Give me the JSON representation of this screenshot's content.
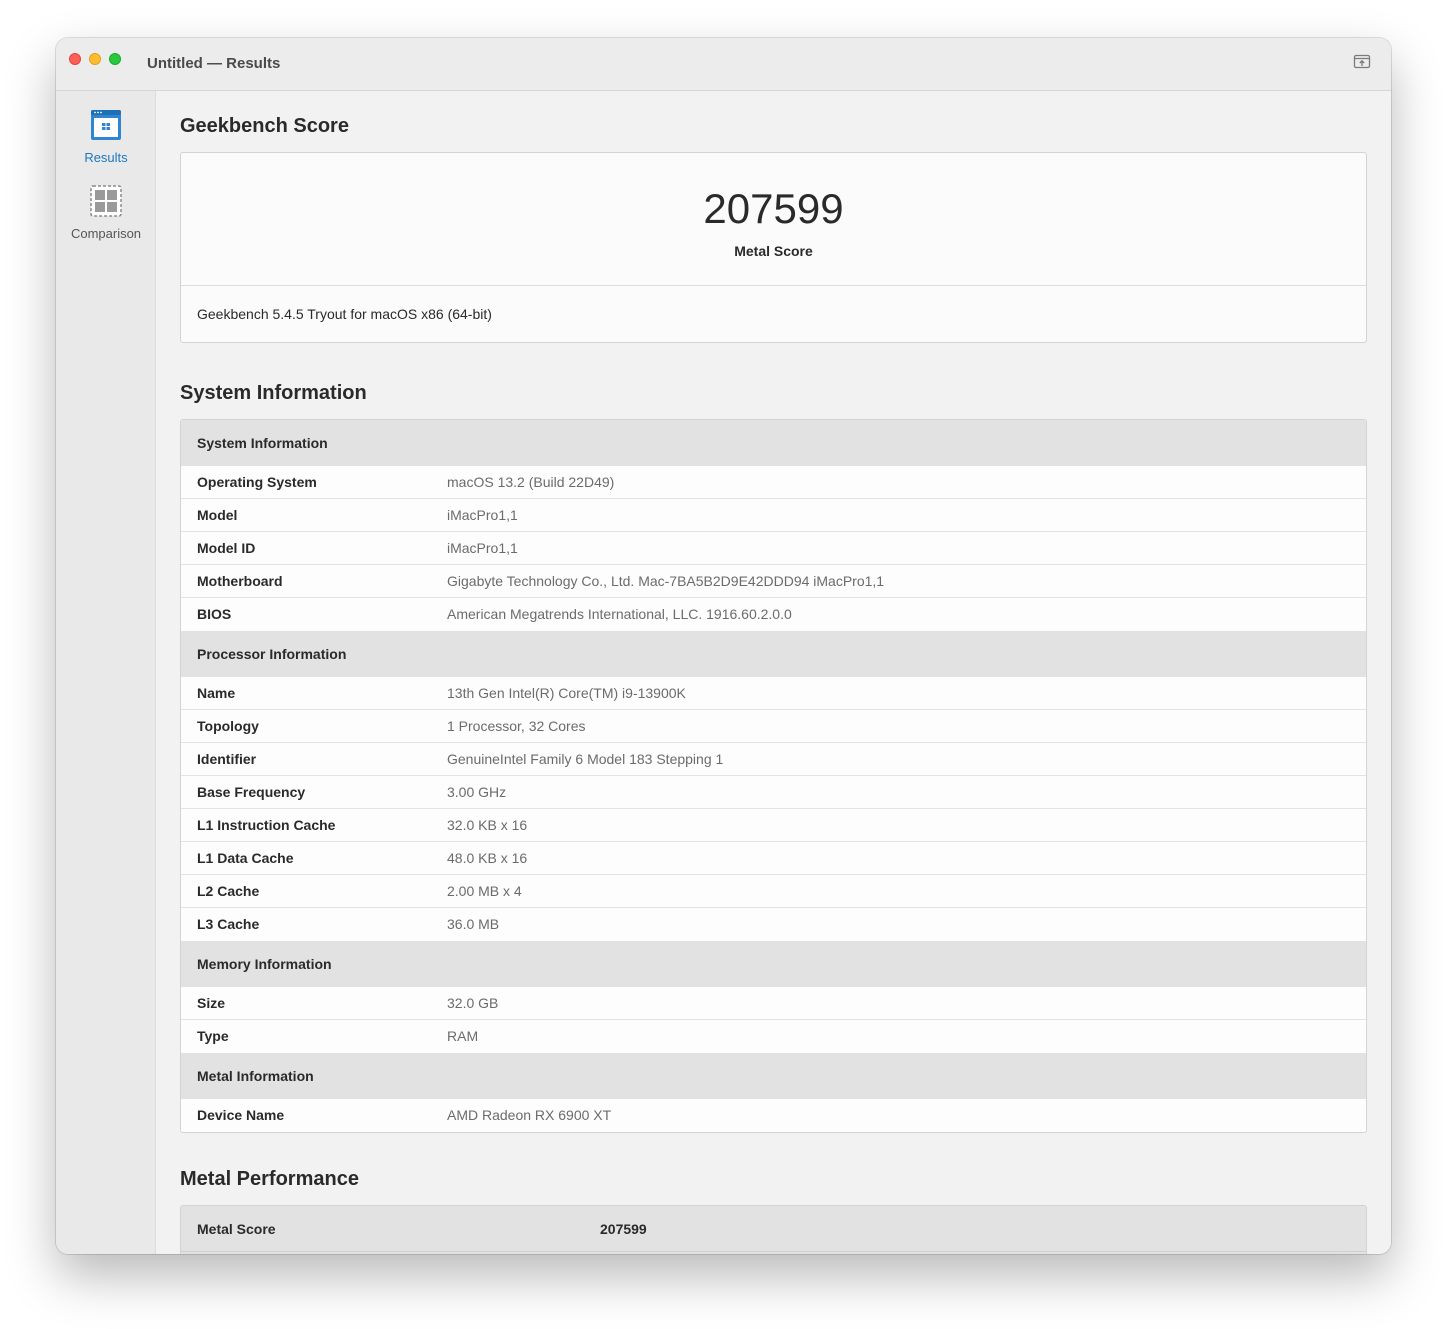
{
  "window": {
    "title": "Untitled — Results"
  },
  "sidebar": {
    "items": [
      {
        "label": "Results",
        "icon": "results-icon",
        "active": true
      },
      {
        "label": "Comparison",
        "icon": "comparison-icon",
        "active": false
      }
    ]
  },
  "score_section": {
    "title": "Geekbench Score",
    "score": "207599",
    "score_label": "Metal Score",
    "version": "Geekbench 5.4.5 Tryout for macOS x86 (64-bit)"
  },
  "system_section": {
    "title": "System Information",
    "groups": [
      {
        "header": "System Information",
        "rows": [
          {
            "key": "Operating System",
            "value": "macOS 13.2 (Build 22D49)"
          },
          {
            "key": "Model",
            "value": "iMacPro1,1"
          },
          {
            "key": "Model ID",
            "value": "iMacPro1,1"
          },
          {
            "key": "Motherboard",
            "value": "Gigabyte Technology Co., Ltd. Mac-7BA5B2D9E42DDD94 iMacPro1,1"
          },
          {
            "key": "BIOS",
            "value": "American Megatrends International, LLC. 1916.60.2.0.0"
          }
        ]
      },
      {
        "header": "Processor Information",
        "rows": [
          {
            "key": "Name",
            "value": "13th Gen Intel(R) Core(TM) i9-13900K"
          },
          {
            "key": "Topology",
            "value": "1 Processor, 32 Cores"
          },
          {
            "key": "Identifier",
            "value": "GenuineIntel Family 6 Model 183 Stepping 1"
          },
          {
            "key": "Base Frequency",
            "value": "3.00 GHz"
          },
          {
            "key": "L1 Instruction Cache",
            "value": "32.0 KB x 16"
          },
          {
            "key": "L1 Data Cache",
            "value": "48.0 KB x 16"
          },
          {
            "key": "L2 Cache",
            "value": "2.00 MB x 4"
          },
          {
            "key": "L3 Cache",
            "value": "36.0 MB"
          }
        ]
      },
      {
        "header": "Memory Information",
        "rows": [
          {
            "key": "Size",
            "value": "32.0 GB"
          },
          {
            "key": "Type",
            "value": "RAM"
          }
        ]
      },
      {
        "header": "Metal Information",
        "rows": [
          {
            "key": "Device Name",
            "value": "AMD Radeon RX 6900 XT"
          }
        ]
      }
    ]
  },
  "performance_section": {
    "title": "Metal Performance",
    "score_key": "Metal Score",
    "score_value": "207599"
  },
  "colors": {
    "accent": "#1d78c1",
    "close": "#fe5f57",
    "minimize": "#febc2e",
    "maximize": "#28c840"
  }
}
